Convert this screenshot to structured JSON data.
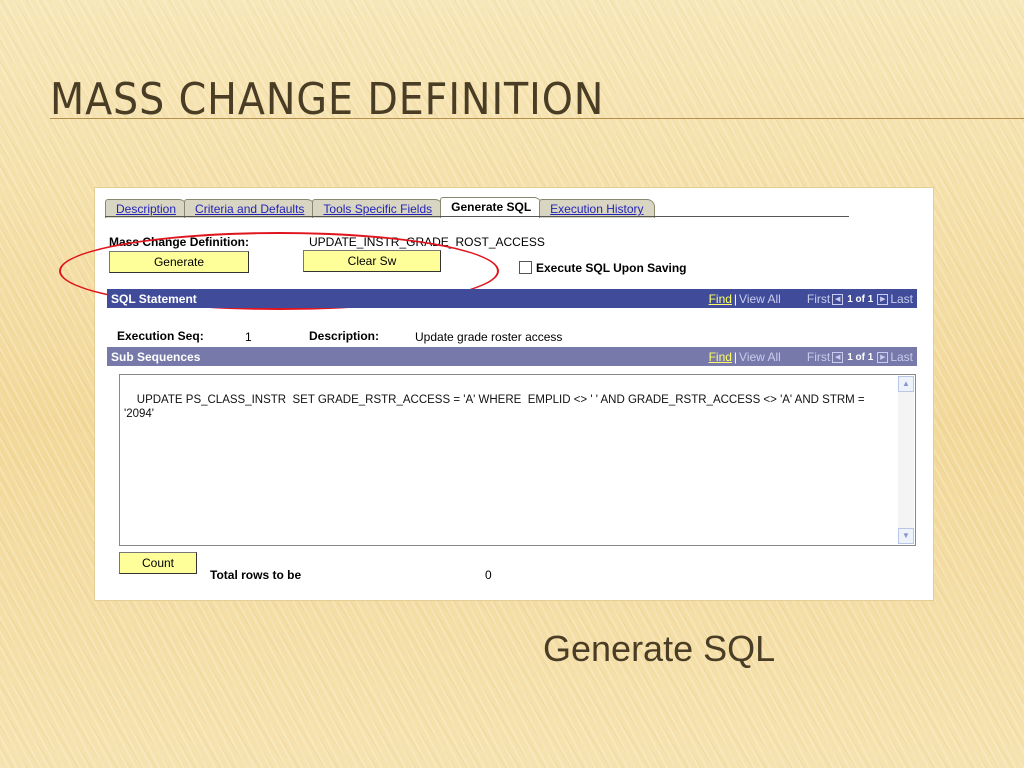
{
  "slide": {
    "title": "Mass Change Definition",
    "caption": "Generate SQL"
  },
  "tabs": [
    {
      "label": "Description",
      "active": false
    },
    {
      "label": "Criteria and Defaults",
      "active": false
    },
    {
      "label": "Tools Specific Fields",
      "active": false
    },
    {
      "label": "Generate SQL",
      "active": true
    },
    {
      "label": "Execution History",
      "active": false
    }
  ],
  "header": {
    "mass_change_label": "Mass Change Definition:",
    "mass_change_value": "UPDATE_INSTR_GRADE_ROST_ACCESS",
    "generate_button": "Generate",
    "clear_button": "Clear Sw",
    "execute_checkbox_label": "Execute SQL Upon Saving",
    "execute_checked": false
  },
  "sql_statement_bar": {
    "title": "SQL Statement",
    "find": "Find",
    "separator": "|",
    "view_all": "View All",
    "first": "First",
    "range": "1 of 1",
    "last": "Last"
  },
  "detail": {
    "exec_seq_label": "Execution Seq:",
    "exec_seq_value": "1",
    "description_label": "Description:",
    "description_value": "Update grade roster access"
  },
  "sub_sequences_bar": {
    "title": "Sub Sequences",
    "find": "Find",
    "separator": "|",
    "view_all": "View All",
    "first": "First",
    "range": "1 of 1",
    "last": "Last"
  },
  "sql_text": "UPDATE PS_CLASS_INSTR  SET GRADE_RSTR_ACCESS = 'A' WHERE  EMPLID <> ' ' AND GRADE_RSTR_ACCESS <> 'A' AND STRM = '2094'",
  "footer": {
    "count_button": "Count",
    "total_label": "Total rows to be",
    "total_value": "0"
  },
  "colors": {
    "bar": "#404c9a",
    "sub_bar": "#7679aa",
    "button": "#ffff99",
    "highlight": "#e0141c"
  }
}
